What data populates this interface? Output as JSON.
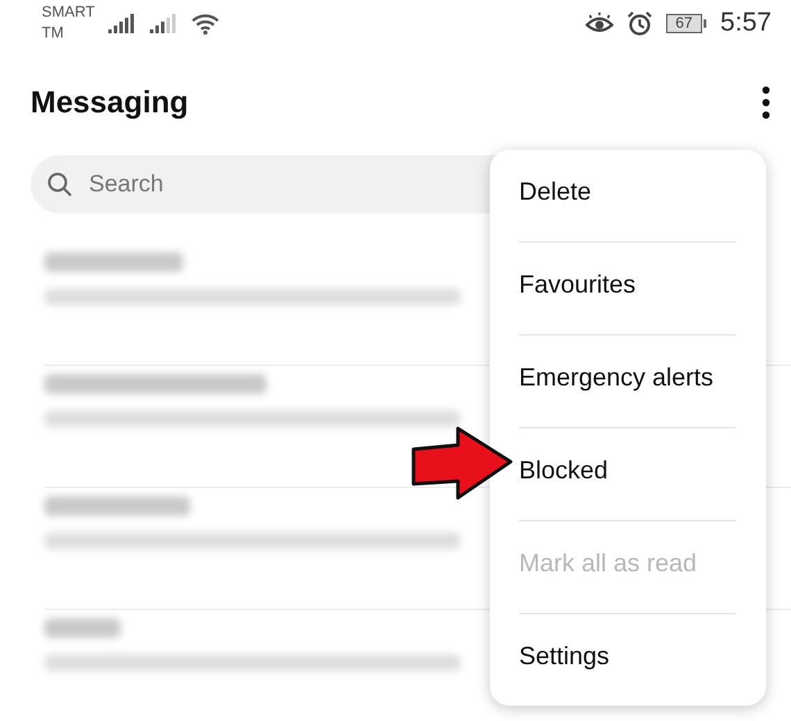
{
  "status_bar": {
    "carrier": [
      "SMART",
      "TM"
    ],
    "battery": "67",
    "time": "5:57"
  },
  "app_bar": {
    "title": "Messaging"
  },
  "search": {
    "placeholder": "Search"
  },
  "conversations": [
    {
      "kind": "redacted"
    },
    {
      "kind": "redacted"
    },
    {
      "kind": "redacted"
    },
    {
      "kind": "redacted"
    }
  ],
  "menu": {
    "items": [
      {
        "label": "Delete",
        "disabled": false
      },
      {
        "label": "Favourites",
        "disabled": false
      },
      {
        "label": "Emergency alerts",
        "disabled": false
      },
      {
        "label": "Blocked",
        "disabled": false,
        "pointed": true
      },
      {
        "label": "Mark all as read",
        "disabled": true
      },
      {
        "label": "Settings",
        "disabled": false
      }
    ]
  }
}
